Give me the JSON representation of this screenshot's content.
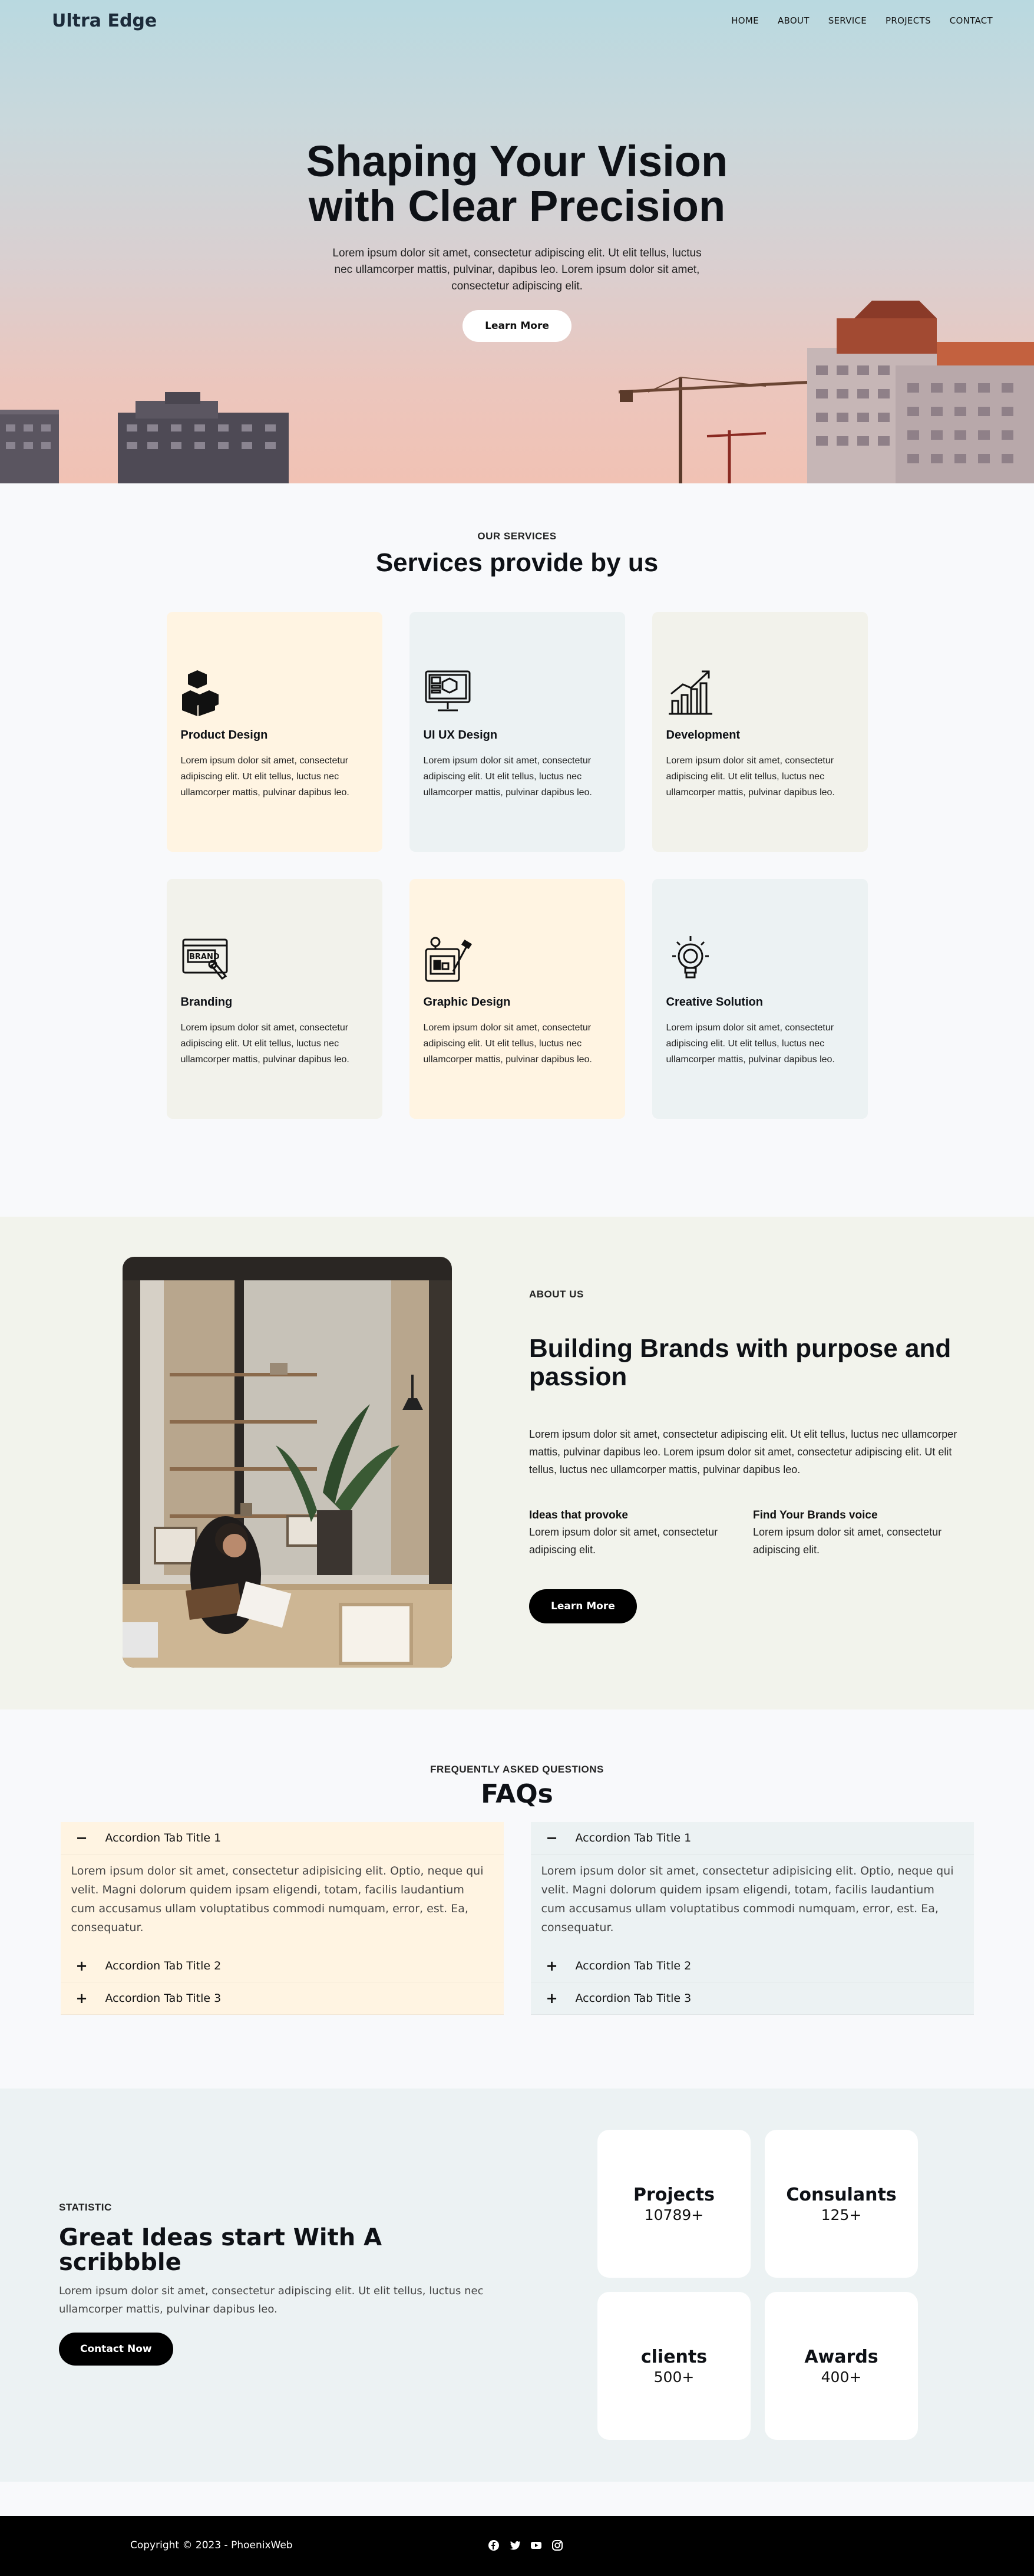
{
  "nav": {
    "logo": "Ultra Edge",
    "links": [
      "HOME",
      "ABOUT",
      "SERVICE",
      "PROJECTS",
      "CONTACT"
    ]
  },
  "hero": {
    "title": "Shaping Your Vision with Clear Precision",
    "text": "Lorem ipsum dolor sit amet, consectetur adipiscing elit. Ut elit tellus, luctus nec ullamcorper mattis, pulvinar, dapibus leo. Lorem ipsum dolor sit amet, consectetur adipiscing elit.",
    "button": "Learn More"
  },
  "services": {
    "eyebrow": "OUR SERVICES",
    "title": "Services provide by us",
    "cards": [
      {
        "title": "Product Design",
        "icon": "cubes-icon",
        "text": "Lorem ipsum dolor sit amet, consectetur adipiscing elit. Ut elit tellus, luctus nec ullamcorper mattis, pulvinar dapibus leo."
      },
      {
        "title": "UI UX Design",
        "icon": "monitor-design-icon",
        "text": "Lorem ipsum dolor sit amet, consectetur adipiscing elit. Ut elit tellus, luctus nec ullamcorper mattis, pulvinar dapibus leo."
      },
      {
        "title": "Development",
        "icon": "growth-chart-icon",
        "text": "Lorem ipsum dolor sit amet, consectetur adipiscing elit. Ut elit tellus, luctus nec ullamcorper mattis, pulvinar dapibus leo."
      },
      {
        "title": "Branding",
        "icon": "brand-icon",
        "text": "Lorem ipsum dolor sit amet, consectetur adipiscing elit. Ut elit tellus, luctus nec ullamcorper mattis, pulvinar dapibus leo."
      },
      {
        "title": "Graphic Design",
        "icon": "graphic-tablet-icon",
        "text": "Lorem ipsum dolor sit amet, consectetur adipiscing elit. Ut elit tellus, luctus nec ullamcorper mattis, pulvinar dapibus leo."
      },
      {
        "title": "Creative Solution",
        "icon": "lightbulb-icon",
        "text": "Lorem ipsum dolor sit amet, consectetur adipiscing elit. Ut elit tellus, luctus nec ullamcorper mattis, pulvinar dapibus leo."
      }
    ]
  },
  "about": {
    "eyebrow": "ABOUT US",
    "title": "Building Brands with purpose and passion",
    "text": "Lorem ipsum dolor sit amet, consectetur adipiscing elit. Ut elit tellus, luctus nec ullamcorper mattis, pulvinar dapibus leo. Lorem ipsum dolor sit amet, consectetur adipiscing elit. Ut elit tellus, luctus nec ullamcorper mattis, pulvinar dapibus leo.",
    "features": [
      {
        "title": "Ideas that provoke",
        "text": "Lorem ipsum dolor sit amet, consectetur adipiscing elit."
      },
      {
        "title": "Find Your Brands voice",
        "text": "Lorem ipsum dolor sit amet, consectetur adipiscing elit."
      }
    ],
    "button": "Learn More"
  },
  "faq": {
    "eyebrow": "FREQUENTLY ASKED QUESTIONS",
    "title": "FAQs",
    "columns": [
      {
        "items": [
          {
            "symbol": "−",
            "title": "Accordion Tab Title 1",
            "body": "Lorem ipsum dolor sit amet, consectetur adipisicing elit. Optio, neque qui velit. Magni dolorum quidem ipsam eligendi, totam, facilis laudantium cum accusamus ullam voluptatibus commodi numquam, error, est. Ea, consequatur."
          },
          {
            "symbol": "+",
            "title": "Accordion Tab Title 2"
          },
          {
            "symbol": "+",
            "title": "Accordion Tab Title 3"
          }
        ]
      },
      {
        "items": [
          {
            "symbol": "−",
            "title": "Accordion Tab Title 1",
            "body": "Lorem ipsum dolor sit amet, consectetur adipisicing elit. Optio, neque qui velit. Magni dolorum quidem ipsam eligendi, totam, facilis laudantium cum accusamus ullam voluptatibus commodi numquam, error, est. Ea, consequatur."
          },
          {
            "symbol": "+",
            "title": "Accordion Tab Title 2"
          },
          {
            "symbol": "+",
            "title": "Accordion Tab Title 3"
          }
        ]
      }
    ]
  },
  "stats": {
    "eyebrow": "STATISTIC",
    "title": "Great Ideas start With A scribbble",
    "text": "Lorem ipsum dolor sit amet, consectetur adipiscing elit. Ut elit tellus, luctus nec ullamcorper mattis, pulvinar dapibus leo.",
    "button": "Contact Now",
    "boxes": [
      {
        "label": "Projects",
        "value": "10789+"
      },
      {
        "label": "Consulants",
        "value": "125+"
      },
      {
        "label": "clients",
        "value": "500+"
      },
      {
        "label": "Awards",
        "value": "400+"
      }
    ]
  },
  "footer": {
    "copyright": "Copyright © 2023 - PhoenixWeb",
    "social": [
      "facebook-icon",
      "twitter-icon",
      "youtube-icon",
      "instagram-icon"
    ]
  },
  "colors": {
    "peach": "#fff4e2",
    "light_blue": "#ecf2f3",
    "cream": "#f2f2eb",
    "about_bg": "#f2f3ec",
    "dark": "#000000"
  }
}
